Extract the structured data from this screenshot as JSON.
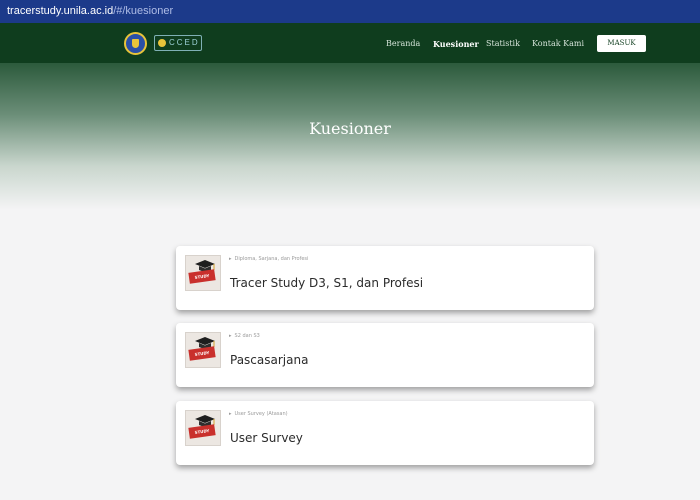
{
  "browser": {
    "url_host": "tracerstudy.unila.ac.id",
    "url_path": "/#/kuesioner"
  },
  "navbar": {
    "logo_text": "CCED",
    "links": [
      {
        "label": "Beranda",
        "active": false
      },
      {
        "label": "Kuesioner",
        "active": true
      },
      {
        "label": "Statistik",
        "active": false
      },
      {
        "label": "Kontak Kami",
        "active": false
      }
    ],
    "login_button": "MASUK",
    "colors": {
      "navbar_bg": "#0f3d1e",
      "accent_gold": "#e8c43a"
    }
  },
  "hero": {
    "title": "Kuesioner"
  },
  "cards": [
    {
      "subtitle": "Diploma, Sarjana, dan Profesi",
      "title": "Tracer Study D3, S1, dan Profesi",
      "icon": "graduation-cap-icon",
      "badge_text": "STUDY"
    },
    {
      "subtitle": "S2 dan S3",
      "title": "Pascasarjana",
      "icon": "graduation-cap-icon",
      "badge_text": "STUDY"
    },
    {
      "subtitle": "User Survey (Atasan)",
      "title": "User Survey",
      "icon": "graduation-cap-icon",
      "badge_text": "STUDY"
    }
  ]
}
